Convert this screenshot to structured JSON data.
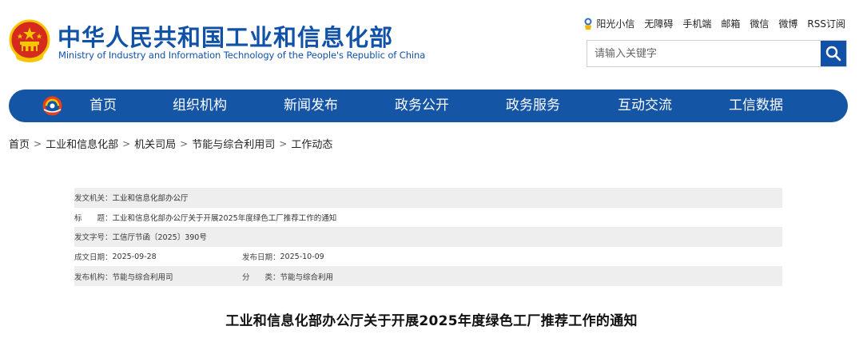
{
  "header": {
    "title": "中华人民共和国工业和信息化部",
    "subtitle": "Ministry of Industry and Information Technology of the People's Republic of China"
  },
  "toplinks": {
    "sunshine": "阳光小信",
    "accessibility": "无障碍",
    "mobile": "手机端",
    "mail": "邮箱",
    "wechat": "微信",
    "weibo": "微博",
    "rss": "RSS订阅"
  },
  "search": {
    "placeholder": "请输入关键字"
  },
  "nav": {
    "items": [
      {
        "label": "首页"
      },
      {
        "label": "组织机构"
      },
      {
        "label": "新闻发布"
      },
      {
        "label": "政务公开"
      },
      {
        "label": "政务服务"
      },
      {
        "label": "互动交流"
      },
      {
        "label": "工信数据"
      }
    ]
  },
  "breadcrumb": {
    "items": [
      "首页",
      "工业和信息化部",
      "机关司局",
      "节能与综合利用司",
      "工作动态"
    ],
    "separator": ">"
  },
  "meta": {
    "issuer_label": "发文机关：",
    "issuer": "工业和信息化部办公厅",
    "title_label": "标　　题：",
    "title": "工业和信息化部办公厅关于开展2025年度绿色工厂推荐工作的通知",
    "docno_label": "发文字号：",
    "docno": "工信厅节函〔2025〕390号",
    "created_label": "成文日期：",
    "created": "2025-09-28",
    "published_label": "发布日期：",
    "published": "2025-10-09",
    "org_label": "发布机构：",
    "org": "节能与综合利用司",
    "category_label": "分　　类：",
    "category": "节能与综合利用"
  },
  "document": {
    "title": "工业和信息化部办公厅关于开展2025年度绿色工厂推荐工作的通知"
  },
  "colors": {
    "brand_blue": "#1152a8",
    "nav_blue": "#1455a5",
    "emblem_red": "#d52b1e",
    "emblem_gold": "#f7c600"
  }
}
